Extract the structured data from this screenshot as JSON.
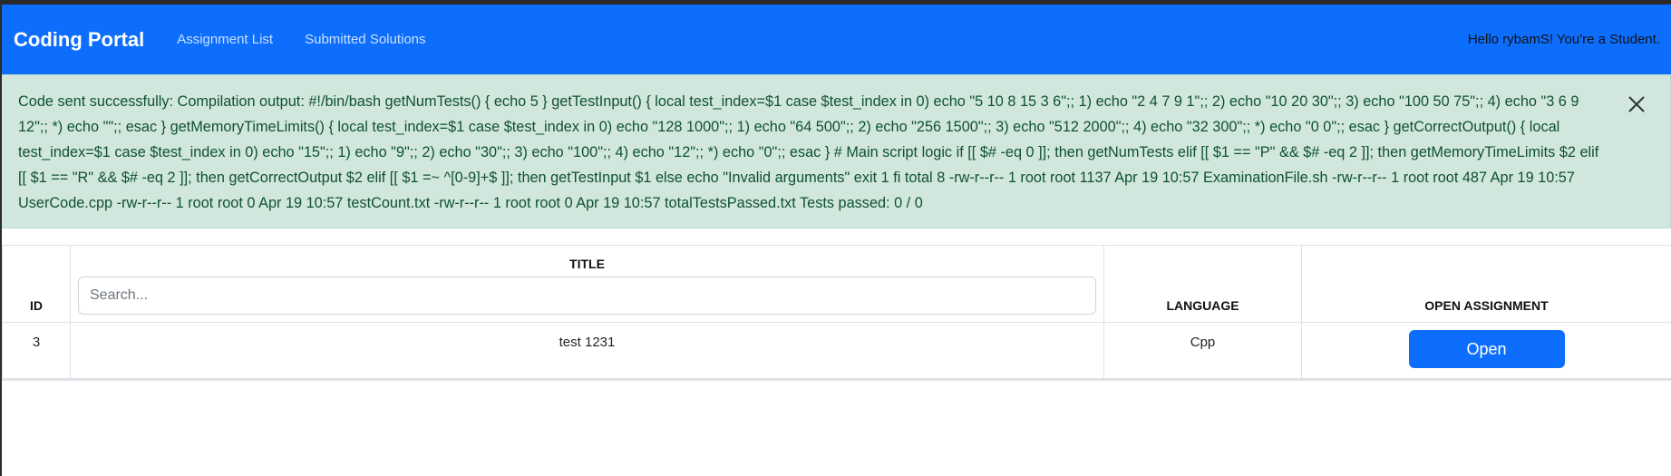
{
  "navbar": {
    "brand": "Coding Portal",
    "links": [
      "Assignment List",
      "Submitted Solutions"
    ],
    "greeting": "Hello rybamS! You're a Student."
  },
  "alert": {
    "message": "Code sent successfully: Compilation output: #!/bin/bash getNumTests() { echo 5 } getTestInput() { local test_index=$1 case $test_index in 0) echo \"5 10 8 15 3 6\";; 1) echo \"2 4 7 9 1\";; 2) echo \"10 20 30\";; 3) echo \"100 50 75\";; 4) echo \"3 6 9 12\";; *) echo \"\";; esac } getMemoryTimeLimits() { local test_index=$1 case $test_index in 0) echo \"128 1000\";; 1) echo \"64 500\";; 2) echo \"256 1500\";; 3) echo \"512 2000\";; 4) echo \"32 300\";; *) echo \"0 0\";; esac } getCorrectOutput() { local test_index=$1 case $test_index in 0) echo \"15\";; 1) echo \"9\";; 2) echo \"30\";; 3) echo \"100\";; 4) echo \"12\";; *) echo \"0\";; esac } # Main script logic if [[ $# -eq 0 ]]; then getNumTests elif [[ $1 == \"P\" && $# -eq 2 ]]; then getMemoryTimeLimits $2 elif [[ $1 == \"R\" && $# -eq 2 ]]; then getCorrectOutput $2 elif [[ $1 =~ ^[0-9]+$ ]]; then getTestInput $1 else echo \"Invalid arguments\" exit 1 fi total 8 -rw-r--r-- 1 root root 1137 Apr 19 10:57 ExaminationFile.sh -rw-r--r-- 1 root root 487 Apr 19 10:57 UserCode.cpp -rw-r--r-- 1 root root 0 Apr 19 10:57 testCount.txt -rw-r--r-- 1 root root 0 Apr 19 10:57 totalTestsPassed.txt Tests passed: 0 / 0",
    "close_icon": "close-icon",
    "color": "#0f5132",
    "background": "#d1e7dd"
  },
  "table": {
    "headers": {
      "id": "ID",
      "title": "TITLE",
      "language": "LANGUAGE",
      "open": "OPEN ASSIGNMENT"
    },
    "search": {
      "placeholder": "Search..."
    },
    "rows": [
      {
        "id": "3",
        "title": "test 1231",
        "language": "Cpp",
        "action": "Open"
      }
    ]
  },
  "colors": {
    "primary": "#0d6efd"
  }
}
